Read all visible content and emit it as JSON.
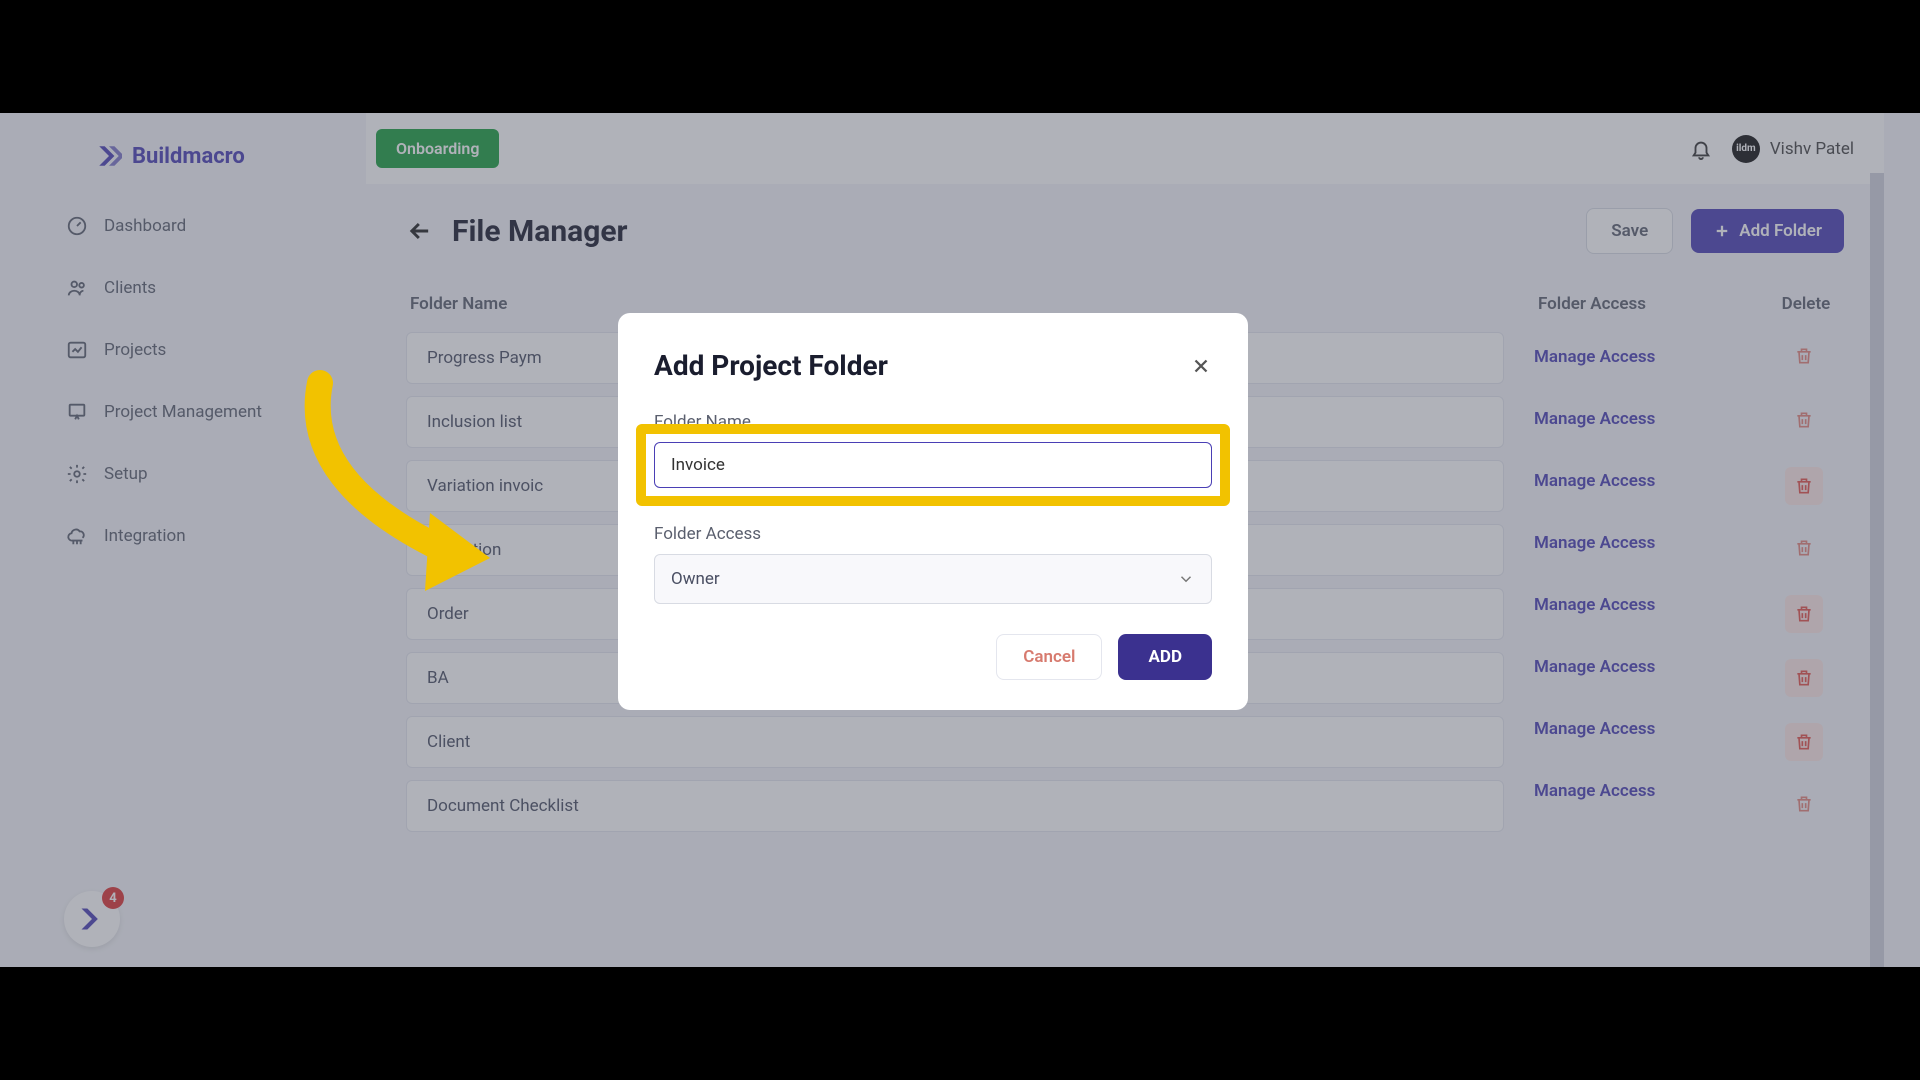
{
  "brand": {
    "name": "Buildmacro"
  },
  "nav": {
    "items": [
      {
        "label": "Dashboard"
      },
      {
        "label": "Clients"
      },
      {
        "label": "Projects"
      },
      {
        "label": "Project Management"
      },
      {
        "label": "Setup"
      },
      {
        "label": "Integration"
      }
    ],
    "badge_count": "4"
  },
  "topbar": {
    "onboarding_label": "Onboarding",
    "user_name": "Vishv Patel",
    "avatar_text": "ildm"
  },
  "page": {
    "title": "File Manager",
    "save_label": "Save",
    "add_folder_label": "Add Folder",
    "columns": {
      "folder": "Folder Name",
      "access": "Folder Access",
      "delete": "Delete"
    },
    "manage_access_label": "Manage Access",
    "folders": [
      {
        "name": "Progress Paym",
        "trash_active": false
      },
      {
        "name": "Inclusion list",
        "trash_active": false
      },
      {
        "name": "Variation invoic",
        "trash_active": true
      },
      {
        "name": "Quotation",
        "trash_active": false
      },
      {
        "name": "Order",
        "trash_active": true
      },
      {
        "name": "BA",
        "trash_active": true
      },
      {
        "name": "Client",
        "trash_active": true
      },
      {
        "name": "Document Checklist",
        "trash_active": false
      }
    ]
  },
  "modal": {
    "title": "Add Project Folder",
    "folder_name_label": "Folder Name",
    "folder_name_value": "Invoice",
    "folder_access_label": "Folder Access",
    "folder_access_value": "Owner",
    "cancel_label": "Cancel",
    "add_label": "ADD"
  },
  "colors": {
    "primary": "#4a3fb5",
    "highlight": "#f2c200",
    "success": "#1a9e3f",
    "danger": "#e4514a"
  }
}
